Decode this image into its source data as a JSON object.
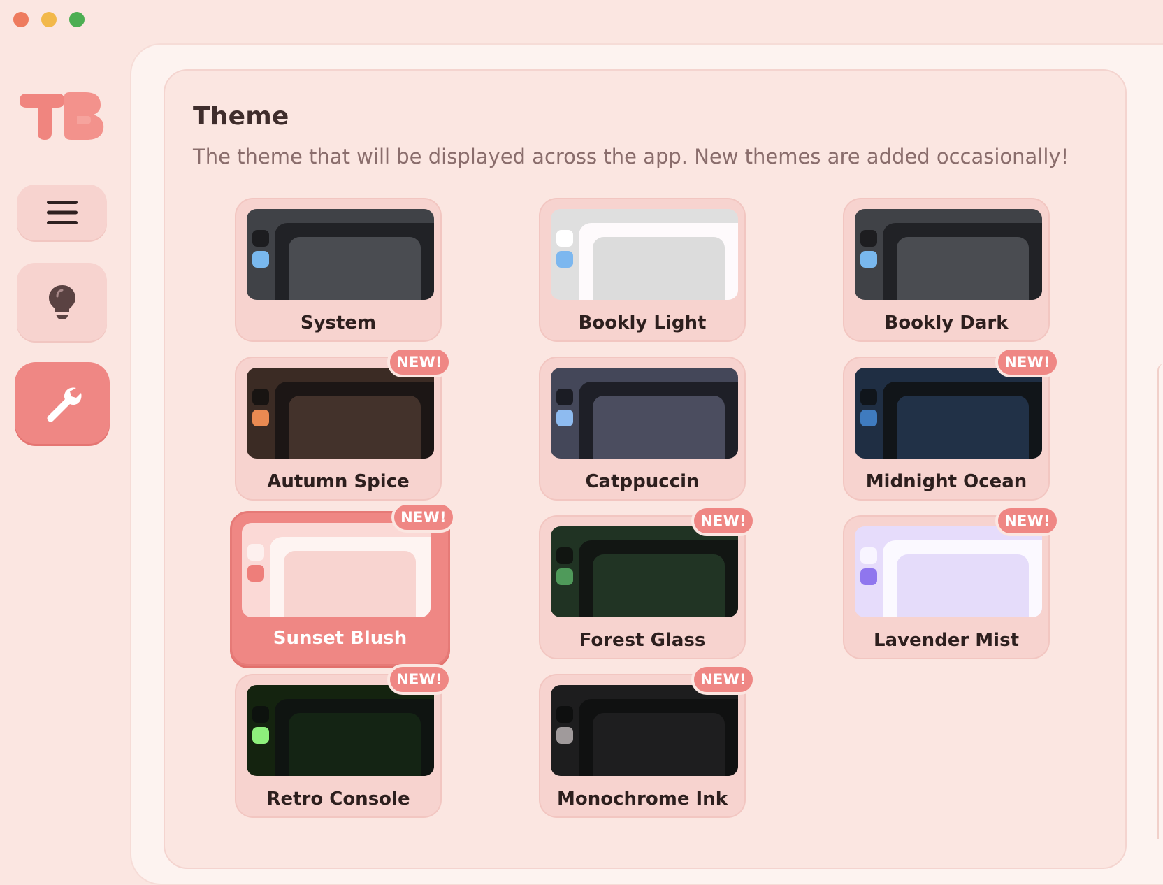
{
  "window": {
    "controls": [
      "close",
      "minimize",
      "zoom"
    ]
  },
  "sidebar": {
    "logo_text": "TB",
    "items": [
      {
        "name": "menu",
        "icon": "hamburger-menu-icon",
        "active": false
      },
      {
        "name": "tips",
        "icon": "lightbulb-icon",
        "active": false
      },
      {
        "name": "settings",
        "icon": "wrench-icon",
        "active": true
      }
    ]
  },
  "settings": {
    "title": "Theme",
    "description": "The theme that will be displayed across the app. New themes are added occasionally!",
    "new_badge": "NEW!"
  },
  "themes": [
    {
      "name": "System",
      "is_new": false,
      "selected": false
    },
    {
      "name": "Bookly Light",
      "is_new": false,
      "selected": false
    },
    {
      "name": "Bookly Dark",
      "is_new": false,
      "selected": false
    },
    {
      "name": "Autumn Spice",
      "is_new": true,
      "selected": false
    },
    {
      "name": "Catppuccin",
      "is_new": false,
      "selected": false
    },
    {
      "name": "Midnight Ocean",
      "is_new": true,
      "selected": false
    },
    {
      "name": "Sunset Blush",
      "is_new": true,
      "selected": true
    },
    {
      "name": "Forest Glass",
      "is_new": true,
      "selected": false
    },
    {
      "name": "Lavender Mist",
      "is_new": true,
      "selected": false
    },
    {
      "name": "Retro Console",
      "is_new": true,
      "selected": false
    },
    {
      "name": "Monochrome Ink",
      "is_new": true,
      "selected": false
    }
  ],
  "colors": {
    "accent": "#ef8784",
    "background": "#fbe6e1",
    "card": "#f7d3cf",
    "text": "#3f2d2c",
    "subtext": "#8a6d6c"
  }
}
